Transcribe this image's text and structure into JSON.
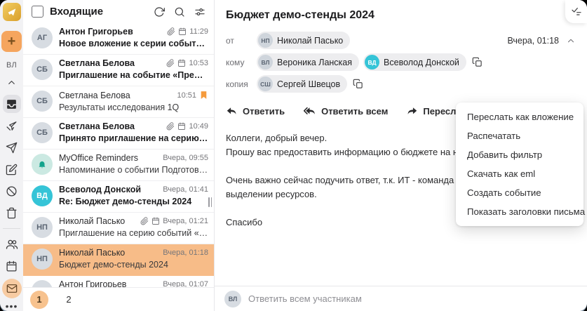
{
  "sidebar": {
    "user_initials": "ВЛ",
    "icons": [
      "add",
      "collapse",
      "inbox",
      "scheduled",
      "sent",
      "drafts",
      "spam",
      "trash",
      "contacts",
      "calendar",
      "mail",
      "more"
    ],
    "active_folder": "inbox",
    "active_app": "mail"
  },
  "list": {
    "title": "Входящие",
    "header_icons": [
      "refresh-icon",
      "search-icon",
      "filter-icon"
    ],
    "emails": [
      {
        "sender": "Антон Григорьев",
        "subject": "Новое вложение к серии событий «Аналити...",
        "time": "11:29",
        "unread": true,
        "attachment": true,
        "event": true,
        "flagged": false,
        "selected": false,
        "avatar": {
          "type": "photo",
          "initials": "АГ"
        }
      },
      {
        "sender": "Светлана Белова",
        "subject": "Приглашение на событие «Предварительно...",
        "time": "10:53",
        "unread": true,
        "attachment": true,
        "event": true,
        "flagged": false,
        "selected": false,
        "avatar": {
          "type": "photo",
          "initials": "СБ"
        }
      },
      {
        "sender": "Светлана Белова",
        "subject": "Результаты исследования 1Q",
        "time": "10:51",
        "unread": false,
        "attachment": false,
        "event": false,
        "flagged": true,
        "selected": false,
        "avatar": {
          "type": "photo",
          "initials": "СБ"
        }
      },
      {
        "sender": "Светлана Белова",
        "subject": "Принято приглашение на серию событий «...",
        "time": "10:49",
        "unread": true,
        "attachment": true,
        "event": true,
        "flagged": false,
        "selected": false,
        "avatar": {
          "type": "photo",
          "initials": "СБ"
        }
      },
      {
        "sender": "MyOffice Reminders",
        "subject": "Напоминание о событии Подготовить отчет...",
        "time": "Вчера, 09:55",
        "unread": false,
        "attachment": false,
        "event": false,
        "flagged": false,
        "selected": false,
        "avatar": {
          "type": "bell"
        }
      },
      {
        "sender": "Всеволод Донской",
        "subject": "Re: Бюджет демо-стенды 2024",
        "time": "Вчера, 01:41",
        "unread": true,
        "attachment": false,
        "event": false,
        "flagged": false,
        "selected": false,
        "avatar": {
          "type": "badge",
          "initials": "ВД"
        }
      },
      {
        "sender": "Николай Пасько",
        "subject": "Приглашение на серию событий «Демо стен...",
        "time": "Вчера, 01:21",
        "unread": false,
        "attachment": true,
        "event": true,
        "flagged": false,
        "selected": false,
        "avatar": {
          "type": "photo",
          "initials": "НП"
        }
      },
      {
        "sender": "Николай Пасько",
        "subject": "Бюджет демо-стенды 2024",
        "time": "Вчера, 01:18",
        "unread": false,
        "attachment": false,
        "event": false,
        "flagged": false,
        "selected": true,
        "avatar": {
          "type": "photo",
          "initials": "НП"
        }
      },
      {
        "sender": "Антон Григорьев",
        "subject": "",
        "time": "Вчера, 01:07",
        "unread": false,
        "attachment": false,
        "event": false,
        "flagged": false,
        "selected": false,
        "avatar": {
          "type": "photo",
          "initials": "АГ"
        }
      }
    ],
    "pagination": {
      "pages": [
        "1",
        "2"
      ],
      "current": "1"
    }
  },
  "detail": {
    "subject": "Бюджет демо-стенды 2024",
    "date": "Вчера, 01:18",
    "side_tab_icon": "tasks-icon",
    "fields": [
      {
        "label": "от",
        "copy": false,
        "chips": [
          {
            "name": "Николай Пасько",
            "initials": "НП",
            "type": "photo"
          }
        ]
      },
      {
        "label": "кому",
        "copy": true,
        "chips": [
          {
            "name": "Вероника Ланская",
            "initials": "ВЛ",
            "type": "photo"
          },
          {
            "name": "Всеволод Донской",
            "initials": "ВД",
            "type": "badge"
          }
        ]
      },
      {
        "label": "копия",
        "copy": true,
        "chips": [
          {
            "name": "Сергей Швецов",
            "initials": "СШ",
            "type": "photo"
          }
        ]
      }
    ],
    "actions": [
      {
        "id": "reply",
        "label": "Ответить"
      },
      {
        "id": "reply-all",
        "label": "Ответить всем"
      },
      {
        "id": "forward",
        "label": "Переслать"
      }
    ],
    "toolbar_icons": [
      "open-in-new-icon",
      "delete-icon",
      "tag-icon",
      "more-vertical-icon"
    ],
    "body_lines": [
      "Коллеги, добрый вечер.",
      "Прошу вас предоставить информацию о бюджете на наши демонстраци",
      "",
      "Очень важно сейчас подучить ответ, т.к. ИТ - команда Всеволода, уже",
      "выделении ресурсов.",
      "",
      "Спасибо"
    ],
    "reply_bar": {
      "placeholder": "Ответить всем участникам",
      "avatar_initials": "ВЛ"
    }
  },
  "context_menu": {
    "items": [
      "Переслать как вложение",
      "Распечатать",
      "Добавить фильтр",
      "Скачать как eml",
      "Создать событие",
      "Показать заголовки письма"
    ]
  },
  "colors": {
    "accent_orange": "#F5A55E",
    "selection_orange": "#F7BC88",
    "page_circle": "#F7C28E",
    "mail_circle": "#F7CBA2",
    "badge_teal": "#35C4D7",
    "flag_orange": "#F59B3D",
    "bell_teal": "#13A38C",
    "bell_bg": "#CBE9E2"
  }
}
